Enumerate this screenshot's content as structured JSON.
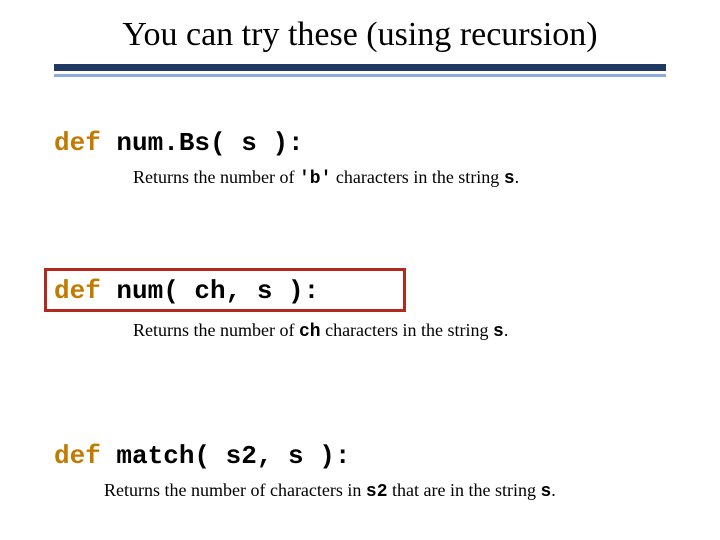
{
  "title": "You can try these (using recursion)",
  "fn1": {
    "kw": "def",
    "sig": " num.Bs( s ):",
    "desc_pre": "Returns the number of ",
    "arg": "'b'",
    "desc_mid": " characters in the string ",
    "str": "s",
    "desc_end": "."
  },
  "fn2": {
    "kw": "def",
    "sig": " num( ch, s ):",
    "desc_pre": "Returns the number of ",
    "arg": "ch",
    "desc_mid": " characters in the string ",
    "str": "s",
    "desc_end": "."
  },
  "fn3": {
    "kw": "def",
    "sig": " match( s2, s ):",
    "desc_pre": "Returns the number of  characters in ",
    "arg": "s2",
    "desc_mid": " that are in the string ",
    "str": "s",
    "desc_end": "."
  }
}
